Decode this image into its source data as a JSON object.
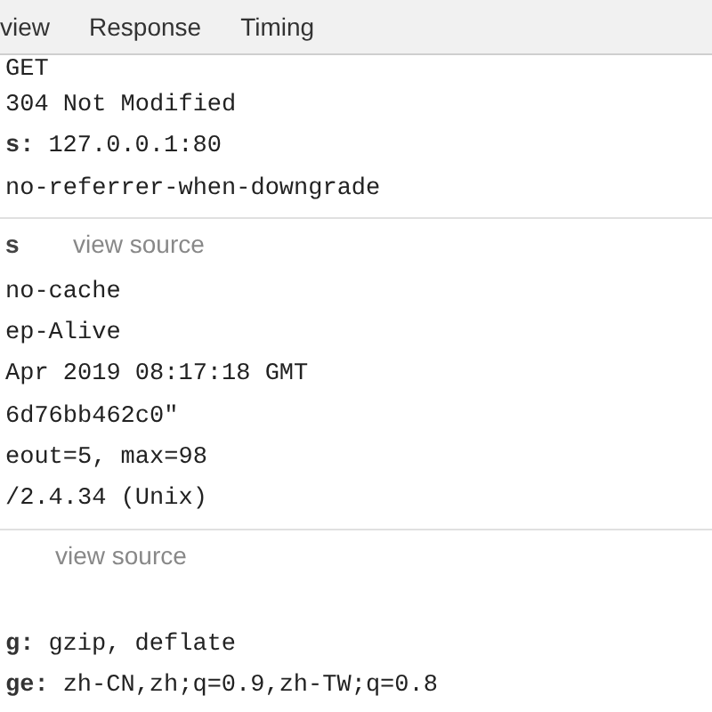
{
  "tabs": [
    {
      "label": "view",
      "selected": false
    },
    {
      "label": "Response",
      "selected": false
    },
    {
      "label": "Timing",
      "selected": false
    }
  ],
  "sections": [
    {
      "rows": [
        {
          "value": "GET"
        },
        {
          "value": "304 Not Modified"
        },
        {
          "key": "s:",
          "value": "127.0.0.1:80"
        },
        {
          "value": "no-referrer-when-downgrade"
        }
      ]
    },
    {
      "title": "s",
      "view_source": "view source",
      "rows": [
        {
          "value": "no-cache"
        },
        {
          "value": "ep-Alive"
        },
        {
          "value": "Apr 2019 08:17:18 GMT"
        },
        {
          "value": "6d76bb462c0\""
        },
        {
          "value": "eout=5, max=98"
        },
        {
          "value": "/2.4.34 (Unix)"
        }
      ]
    },
    {
      "view_source": "view source",
      "rows": [
        {
          "key": "g:",
          "value": "gzip, deflate"
        },
        {
          "key": "ge:",
          "value": "zh-CN,zh;q=0.9,zh-TW;q=0.8"
        }
      ]
    }
  ]
}
